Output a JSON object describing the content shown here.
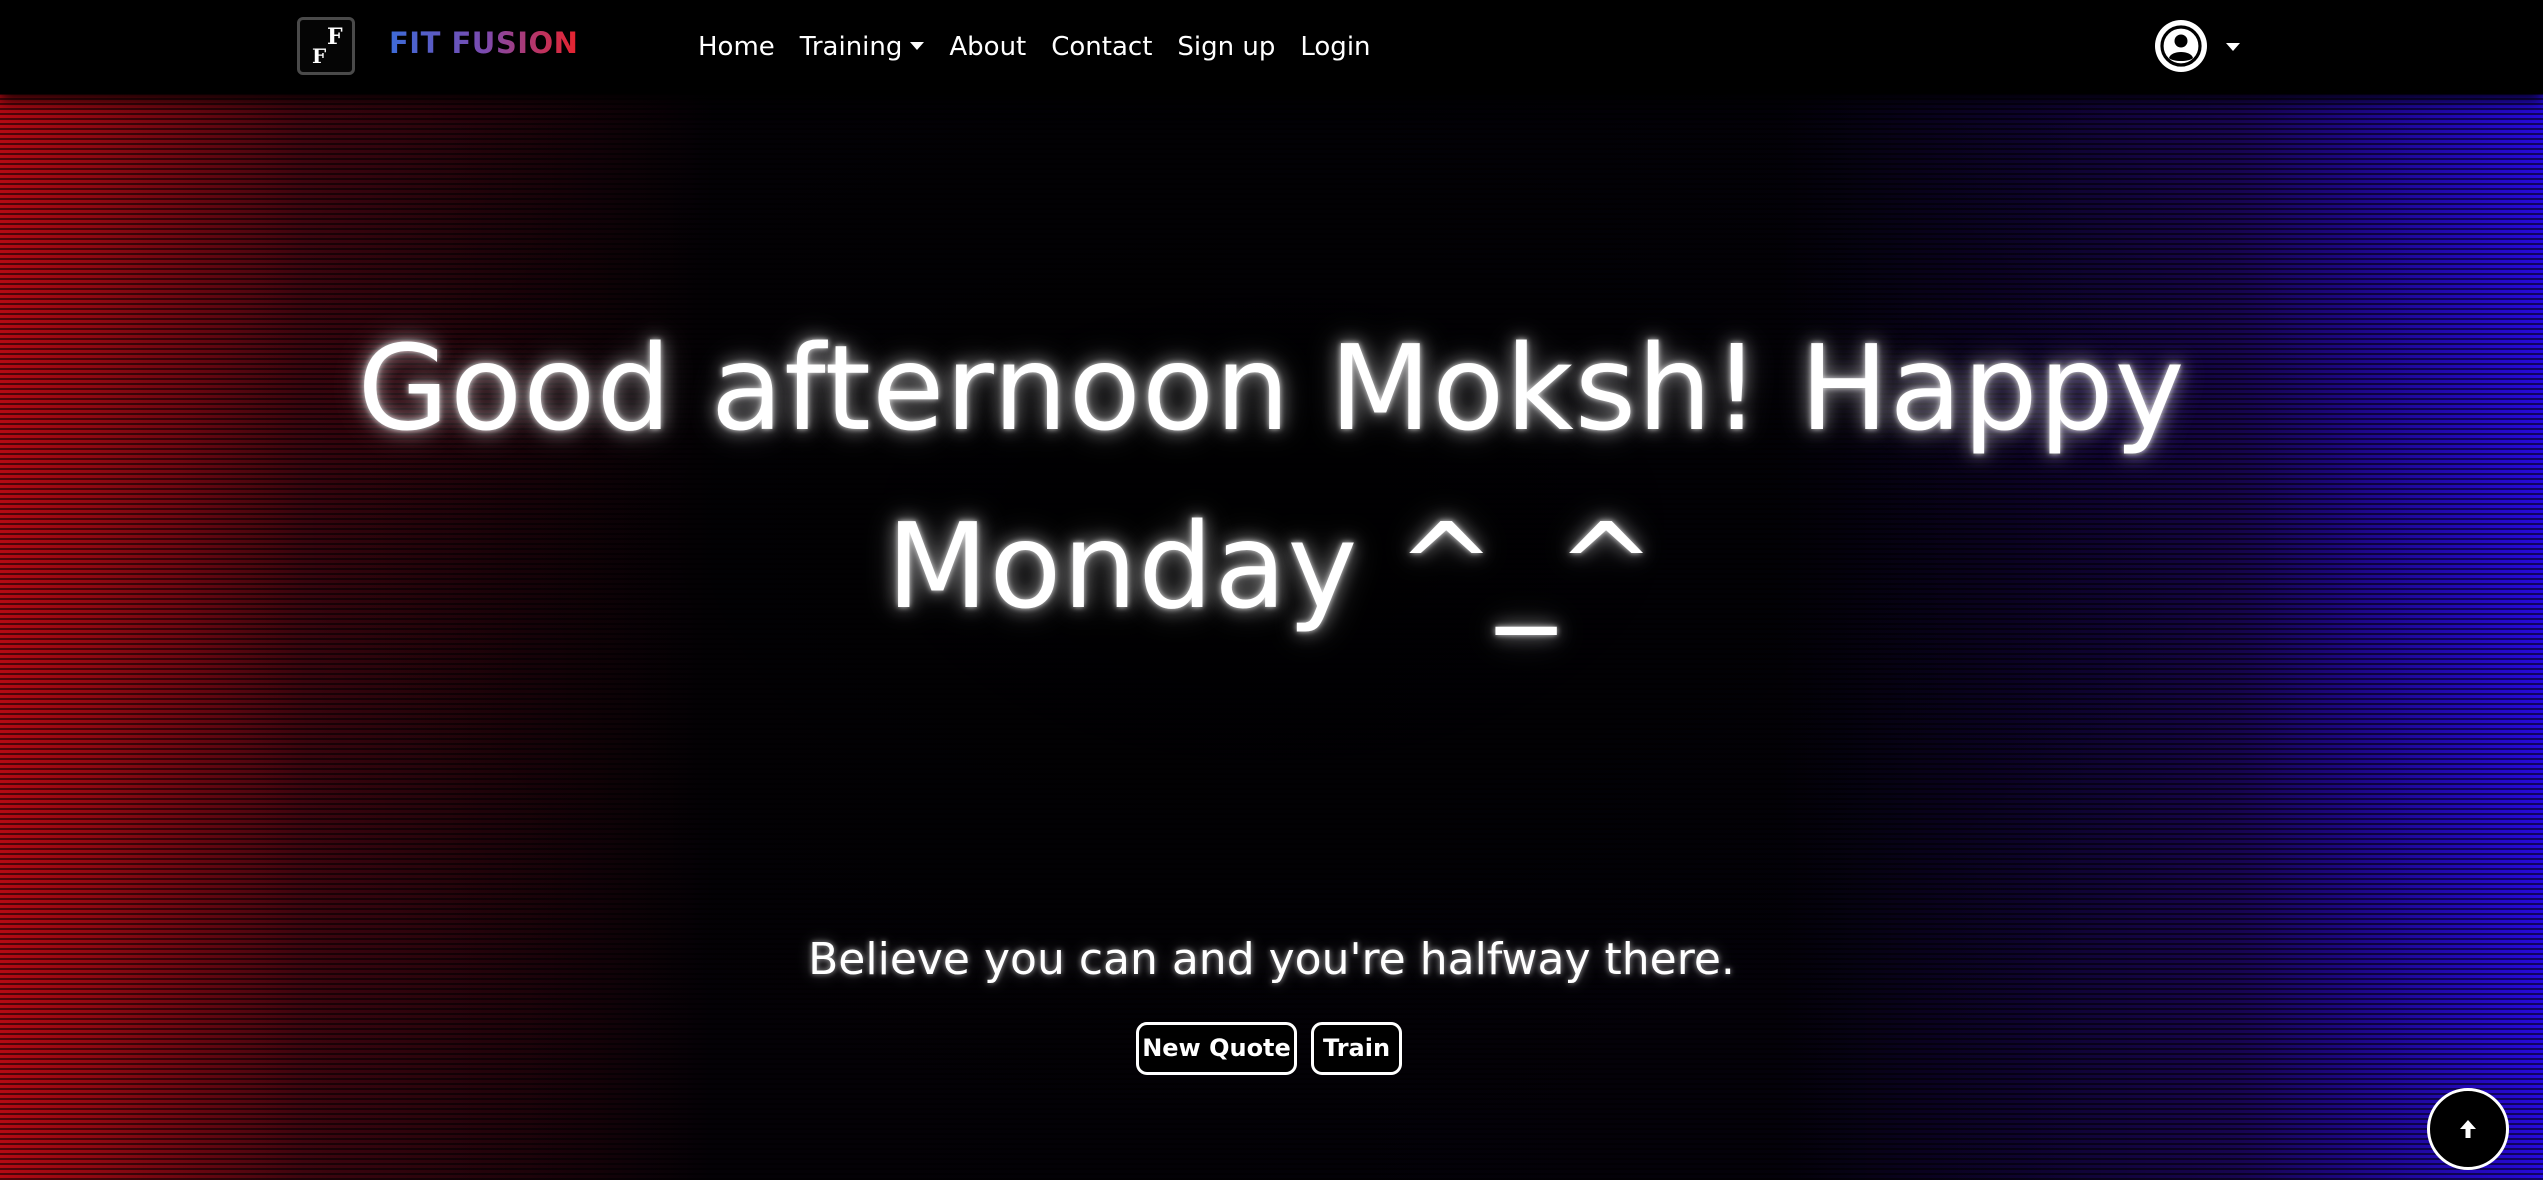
{
  "navbar": {
    "logo": {
      "letters": [
        "F",
        "F"
      ]
    },
    "brand": "FIT FUSION",
    "brand_colors": [
      "#3d6bd8",
      "#e8232d"
    ],
    "links": [
      {
        "label": "Home"
      },
      {
        "label": "Training",
        "has_dropdown": true
      },
      {
        "label": "About"
      },
      {
        "label": "Contact"
      },
      {
        "label": "Sign up"
      },
      {
        "label": "Login"
      }
    ],
    "user_menu": {
      "icon": "user-circle-icon",
      "has_dropdown": true
    }
  },
  "hero": {
    "greeting": "Good afternoon Moksh! Happy Monday ^_^",
    "quote": "Believe you can and you're halfway there.",
    "buttons": {
      "new_quote": "New Quote",
      "train": "Train"
    },
    "gradient_colors": {
      "left": "#be0a14",
      "right": "#2c0ae6"
    }
  },
  "scroll_to_top": {
    "icon": "arrow-up-icon"
  }
}
